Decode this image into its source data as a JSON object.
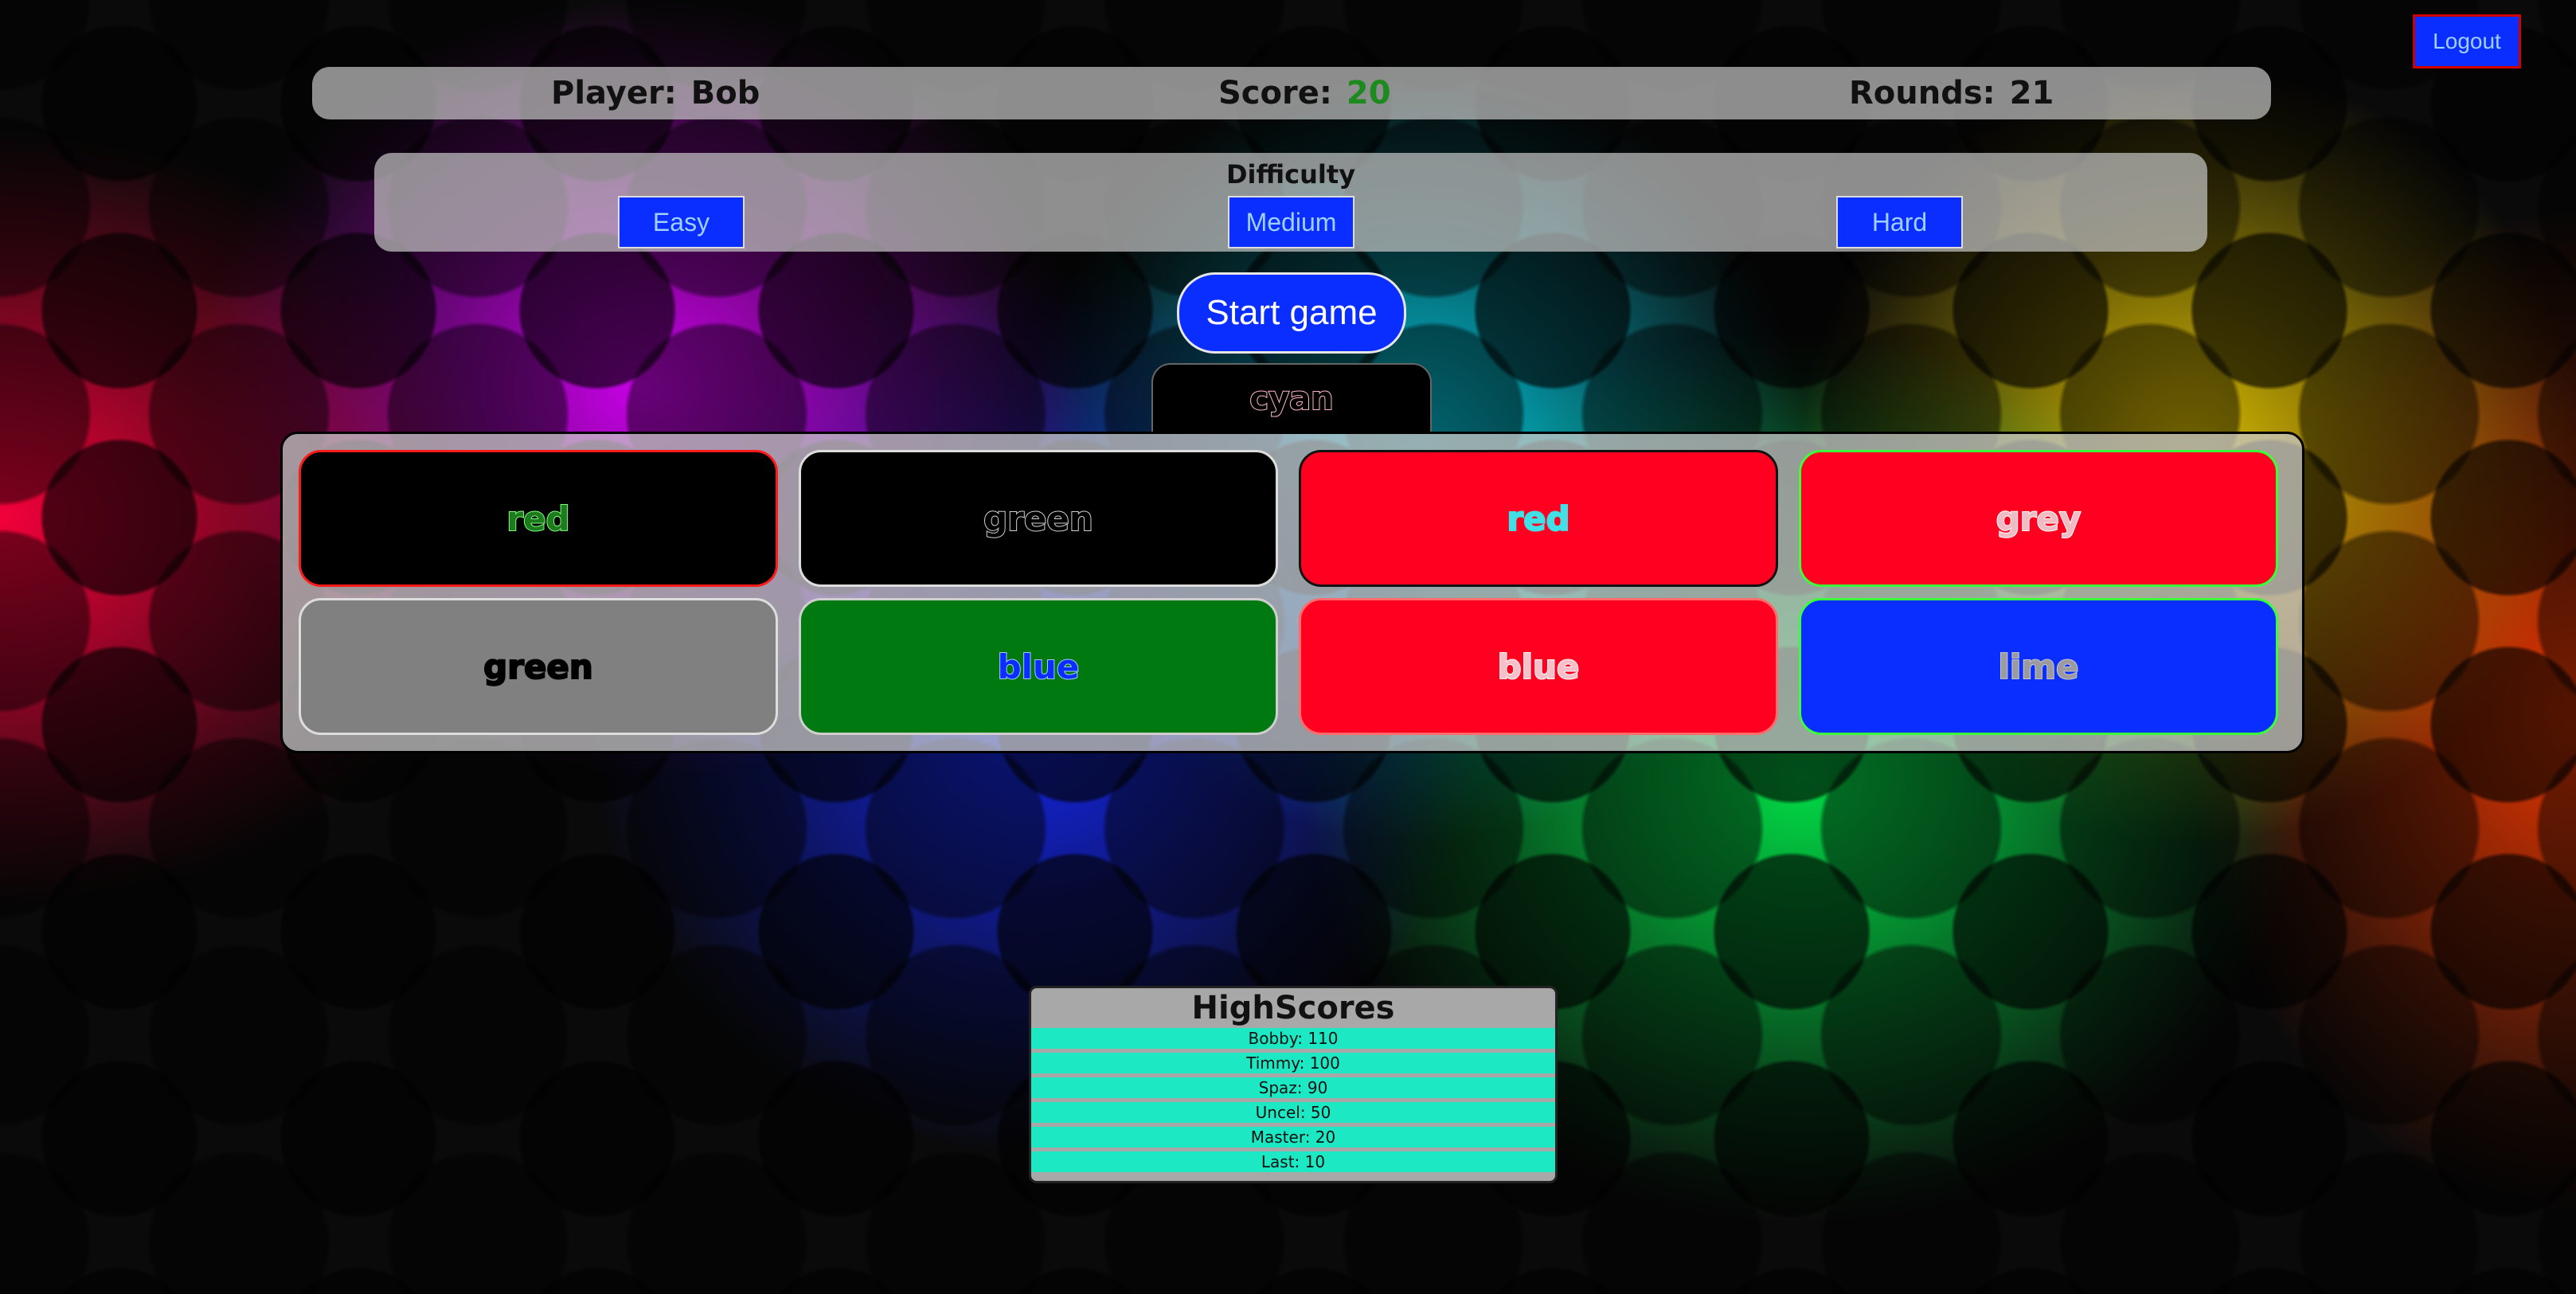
{
  "header": {
    "logout_label": "Logout"
  },
  "status": {
    "player_label": "Player:",
    "player_name": "Bob",
    "score_label": "Score:",
    "score_value": "20",
    "rounds_label": "Rounds:",
    "rounds_value": "21"
  },
  "difficulty": {
    "title": "Difficulty",
    "options": [
      "Easy",
      "Medium",
      "Hard"
    ]
  },
  "start_label": "Start game",
  "target_word": "cyan",
  "cards": [
    {
      "word": "red",
      "bg": "#000000",
      "text": "#1d7a1d",
      "stroke": "#7dff7d",
      "border": "#ff1a1a"
    },
    {
      "word": "green",
      "bg": "#000000",
      "text": "#000000",
      "stroke": "#cfcfcf",
      "border": "#dddddd"
    },
    {
      "word": "red",
      "bg": "#ff0020",
      "text": "#3fe0e6",
      "stroke": "#3fe0e6",
      "border": "#111111"
    },
    {
      "word": "grey",
      "bg": "#ff0020",
      "text": "#f0bcc4",
      "stroke": "#ffffff",
      "border": "#3aff3a"
    },
    {
      "word": "green",
      "bg": "#808080",
      "text": "#000000",
      "stroke": "#000000",
      "border": "#dddddd"
    },
    {
      "word": "blue",
      "bg": "#007a10",
      "text": "#0a2eff",
      "stroke": "#a8c8ff",
      "border": "#cfcfcf"
    },
    {
      "word": "blue",
      "bg": "#ff0020",
      "text": "#f6c0c8",
      "stroke": "#ffffff",
      "border": "#ff6a6a"
    },
    {
      "word": "lime",
      "bg": "#0a2eff",
      "text": "#9a9aa0",
      "stroke": "#c8c8c8",
      "border": "#3aff3a"
    }
  ],
  "highscores": {
    "title": "HighScores",
    "entries": [
      "Bobby: 110",
      "Timmy: 100",
      "Spaz: 90",
      "Uncel: 50",
      "Master: 20",
      "Last: 10"
    ]
  }
}
